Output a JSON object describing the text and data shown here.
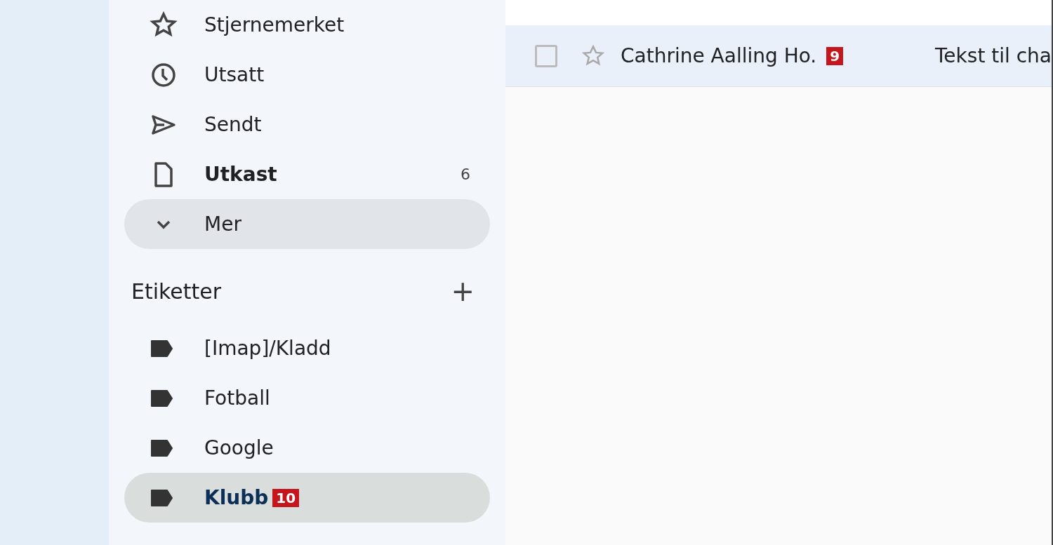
{
  "nav": [
    {
      "kind": "starred",
      "label": "Stjernemerket",
      "unread": false,
      "selected": false
    },
    {
      "kind": "snoozed",
      "label": "Utsatt",
      "unread": false,
      "selected": false
    },
    {
      "kind": "sent",
      "label": "Sendt",
      "unread": false,
      "selected": false
    },
    {
      "kind": "drafts",
      "label": "Utkast",
      "count": "6",
      "unread": true,
      "selected": false
    },
    {
      "kind": "more",
      "label": "Mer",
      "unread": false,
      "selected": true
    }
  ],
  "labels_section": {
    "title": "Etiketter",
    "add": "+"
  },
  "labels": [
    {
      "label": "[Imap]/Kladd",
      "selected": false
    },
    {
      "label": "Fotball",
      "selected": false
    },
    {
      "label": "Google",
      "selected": false
    },
    {
      "label": "Klubb",
      "selected": true,
      "callout": "10"
    }
  ],
  "emails": [
    {
      "checked": false,
      "starred": false,
      "sender": "Cathrine Aalling Ho.",
      "callout": "9",
      "subject": "Tekst til cha"
    }
  ]
}
